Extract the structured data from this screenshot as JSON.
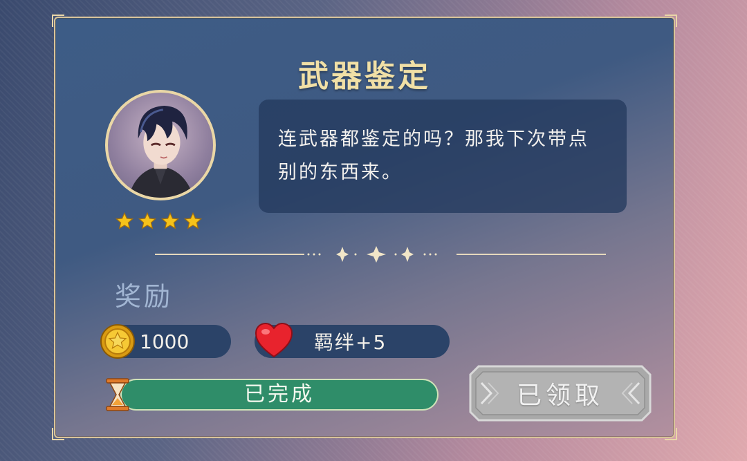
{
  "quest": {
    "title": "武器鉴定",
    "dialogue": "连武器都鉴定的吗？那我下次带点别的东西来。",
    "character": {
      "stars": 4
    }
  },
  "reward": {
    "label": "奖励",
    "coins": "1000",
    "bond": "羁绊+5"
  },
  "status": {
    "progress_label": "已完成",
    "claim_label": "已领取"
  },
  "colors": {
    "title": "#f1e0a6",
    "panel_border": "#d9c49a",
    "progress_fill": "#2f8d69",
    "pill_bg": "#2b4368",
    "claim_button": "#b0b0b0",
    "star": "#f5c21b",
    "heart": "#e8232d"
  },
  "icons": [
    "star-icon",
    "gold-coin-icon",
    "heart-icon",
    "hourglass-icon",
    "sparkle-divider"
  ]
}
